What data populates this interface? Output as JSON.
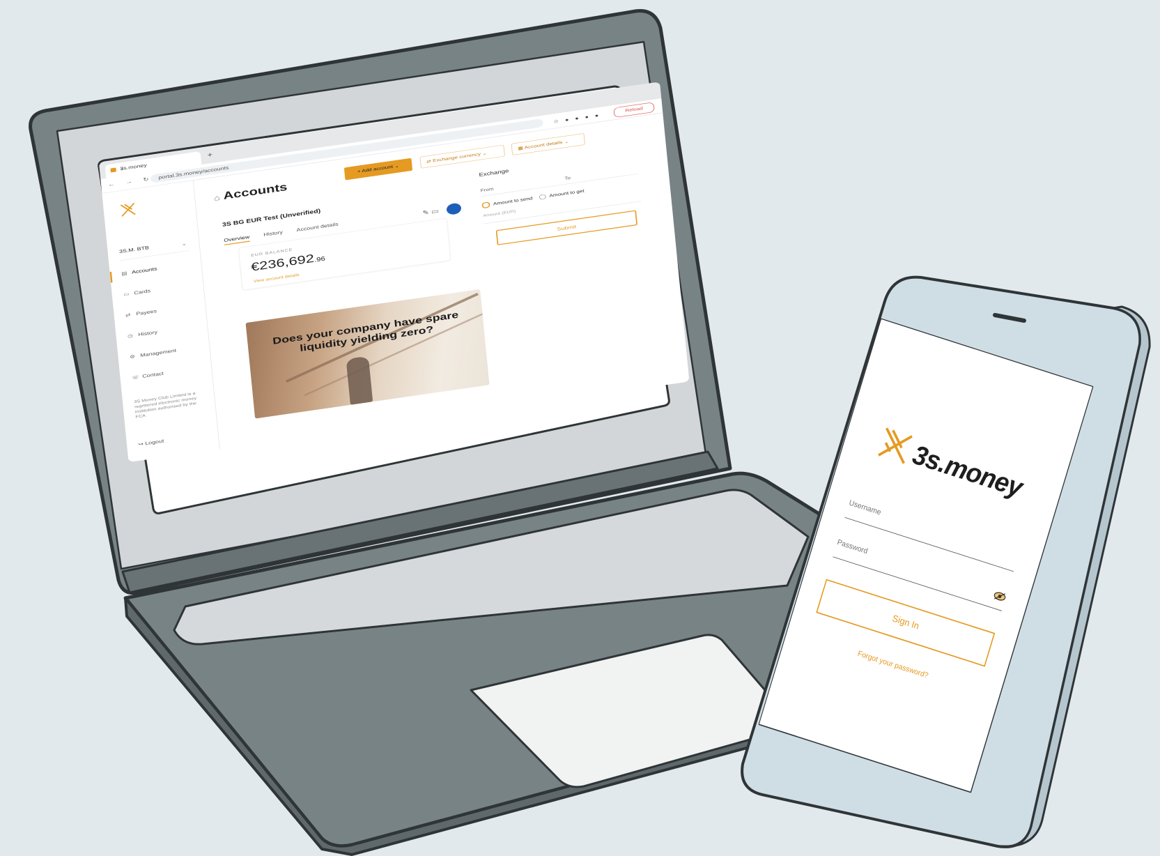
{
  "laptop": {
    "browser": {
      "tab_title": "3s.money",
      "tab_close": "×",
      "new_tab": "+",
      "nav_buttons": "← → ↻",
      "url": "portal.3s.money/accounts",
      "extension_icons": "☆ ● ● ● ●",
      "reload_button": "Reload"
    },
    "sidebar": {
      "company": "3S.M. BTB",
      "company_chevron": "⌄",
      "items": [
        {
          "icon": "▤",
          "label": "Accounts"
        },
        {
          "icon": "▭",
          "label": "Cards"
        },
        {
          "icon": "⇄",
          "label": "Payees"
        },
        {
          "icon": "◷",
          "label": "History"
        },
        {
          "icon": "⚙",
          "label": "Management"
        },
        {
          "icon": "☏",
          "label": "Contact"
        }
      ],
      "note": "3S Money Club Limited is a registered electronic money institution authorised by the FCA",
      "logout": "↪  Logout"
    },
    "header": {
      "title_icon": "⌂",
      "title": "Accounts",
      "add_button": "+ Add account  ⌄",
      "currency_button": "⇄  Exchange currency  ⌄",
      "statement_button": "▦  Account details  ⌄"
    },
    "account": {
      "name": "3S BG EUR Test (Unverified)",
      "tabs": [
        "Overview",
        "History",
        "Account details"
      ],
      "actions": "✎   ▭",
      "balance_label": "EUR BALANCE",
      "balance_main": "€236,692",
      "balance_decimals": ".96",
      "balance_link": "View account details"
    },
    "exchange": {
      "title": "Exchange",
      "from_label": "From",
      "to_label": "To",
      "option_selected": "Amount to send",
      "option_other": "Amount to get",
      "input_placeholder": "Amount (EUR)",
      "submit": "Submit"
    },
    "promo": {
      "text": "Does your company have spare liquidity yielding zero?"
    }
  },
  "phone": {
    "brand": "3s.money",
    "username_label": "Username",
    "password_label": "Password",
    "sign_in": "Sign In",
    "forgot": "Forgot your password?"
  },
  "colors": {
    "background": "#e2e9ec",
    "device_body": "#788385",
    "device_outline": "#2f3537",
    "accent": "#e59a22",
    "phone_body": "#cfdde5"
  }
}
